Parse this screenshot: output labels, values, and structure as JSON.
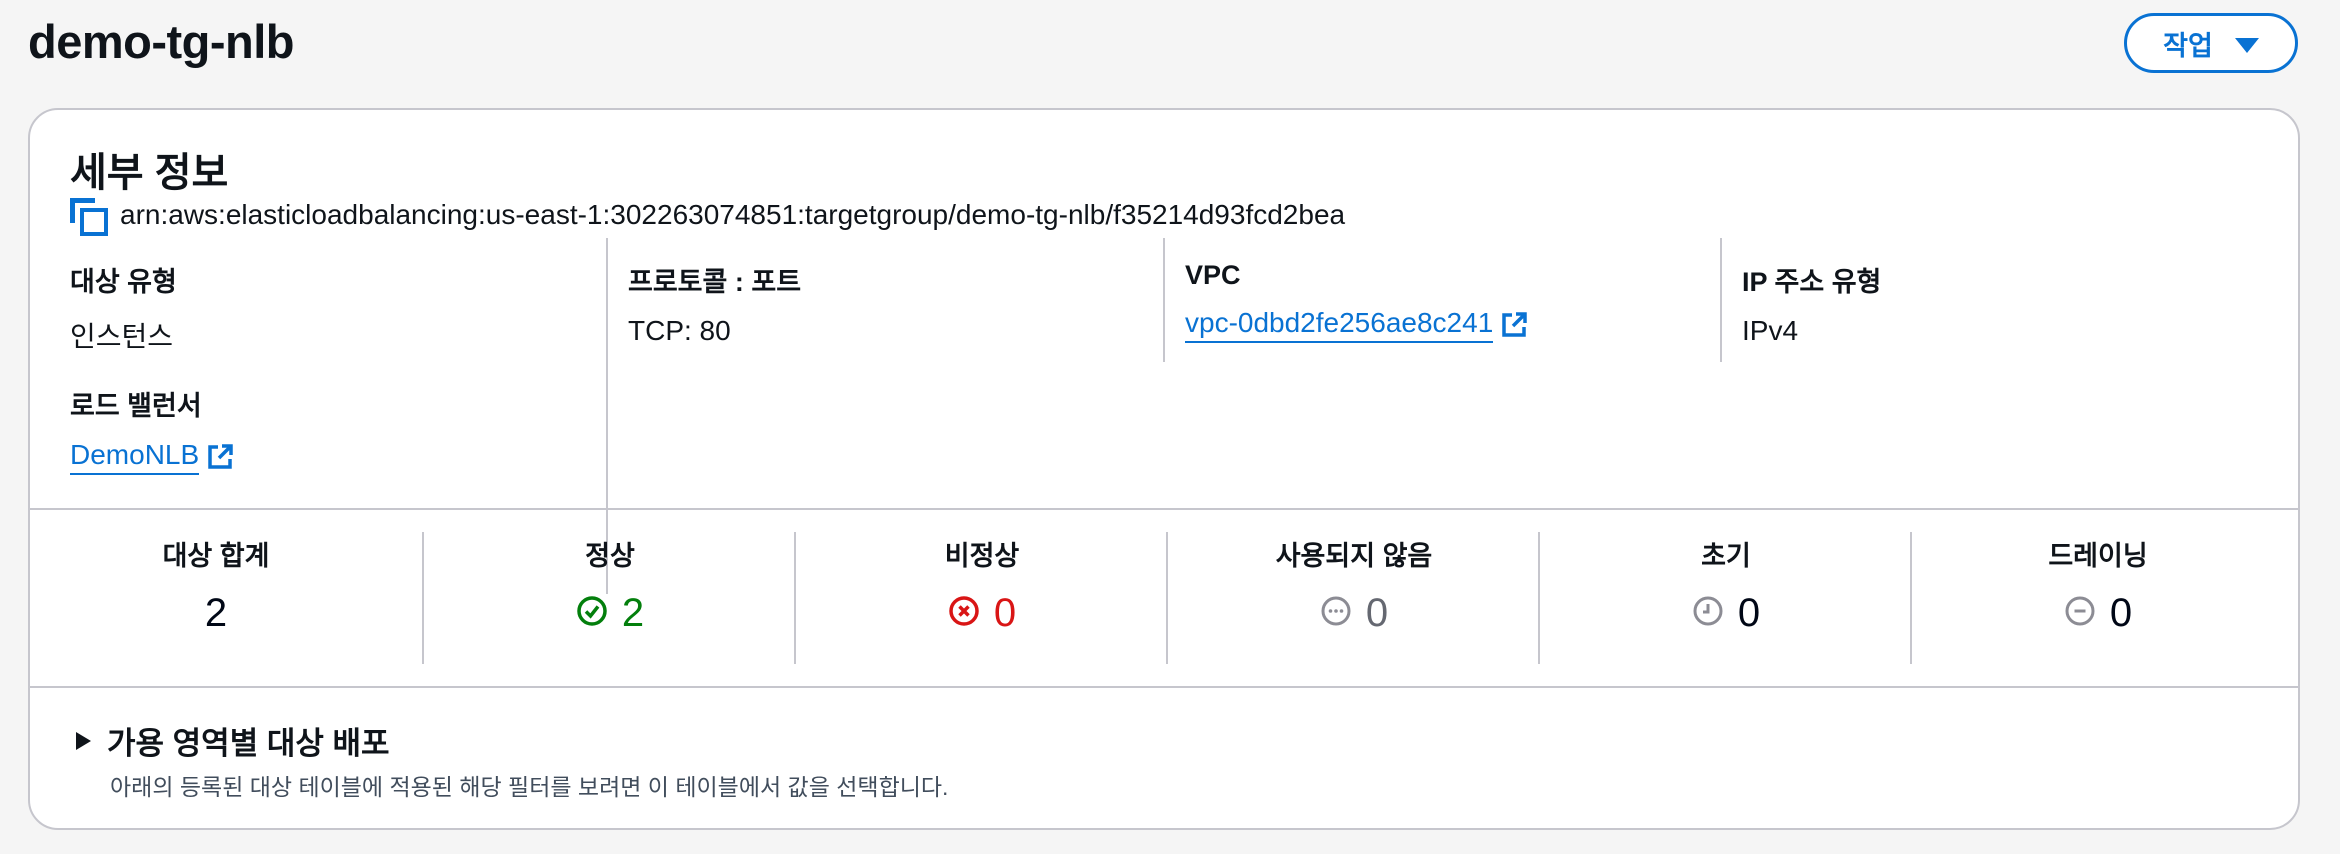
{
  "header": {
    "title": "demo-tg-nlb",
    "actions_label": "작업"
  },
  "details": {
    "title": "세부 정보",
    "arn": "arn:aws:elasticloadbalancing:us-east-1:302263074851:targetgroup/demo-tg-nlb/f35214d93fcd2bea",
    "target_type_label": "대상 유형",
    "target_type_value": "인스턴스",
    "load_balancer_label": "로드 밸런서",
    "load_balancer_value": "DemoNLB",
    "protocol_port_label": "프로토콜 : 포트",
    "protocol_port_value": "TCP: 80",
    "vpc_label": "VPC",
    "vpc_value": "vpc-0dbd2fe256ae8c241",
    "ip_type_label": "IP 주소 유형",
    "ip_type_value": "IPv4"
  },
  "stats": [
    {
      "label": "대상 합계",
      "value": "2",
      "icon": "none",
      "color": "#000716"
    },
    {
      "label": "정상",
      "value": "2",
      "icon": "check-circle-icon",
      "color": "#037f0c"
    },
    {
      "label": "비정상",
      "value": "0",
      "icon": "x-circle-icon",
      "color": "#d91515"
    },
    {
      "label": "사용되지 않음",
      "value": "0",
      "icon": "ellipsis-circle-icon",
      "color": "#656871"
    },
    {
      "label": "초기",
      "value": "0",
      "icon": "clock-icon",
      "color": "#000716"
    },
    {
      "label": "드레이닝",
      "value": "0",
      "icon": "minus-circle-icon",
      "color": "#000716"
    }
  ],
  "az_section": {
    "title": "가용 영역별 대상 배포",
    "description": "아래의 등록된 대상 테이블에 적용된 해당 필터를 보려면 이 테이블에서 값을 선택합니다."
  },
  "colors": {
    "accent": "#0972d3",
    "success": "#037f0c",
    "error": "#d91515",
    "neutral": "#656871"
  }
}
